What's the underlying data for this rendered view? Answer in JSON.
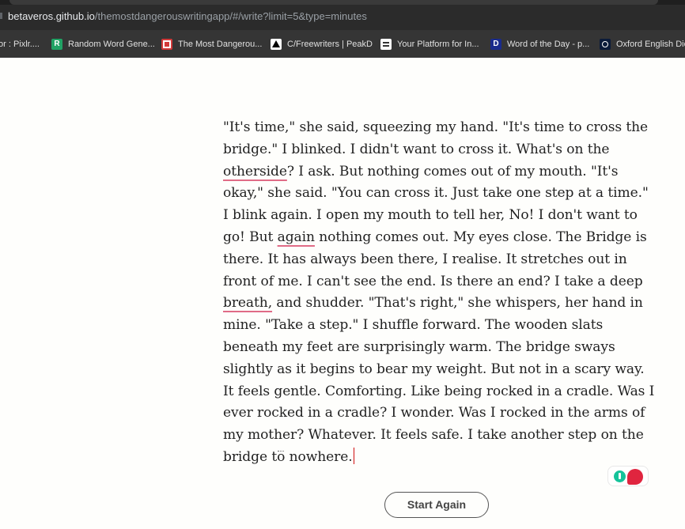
{
  "browser": {
    "url_host": "betaveros.github.io",
    "url_path": "/themostdangerouswritingapp/#/write?limit=5&type=minutes"
  },
  "bookmarks": [
    {
      "label": "or : Pixlr....",
      "icon": "none"
    },
    {
      "label": "Random Word Gene...",
      "icon": "random-word-icon"
    },
    {
      "label": "The Most Dangerou...",
      "icon": "most-dangerous-icon"
    },
    {
      "label": "C/Freewriters | PeakD",
      "icon": "peakd-icon"
    },
    {
      "label": "Your Platform for In...",
      "icon": "platform-icon"
    },
    {
      "label": "Word of the Day - p...",
      "icon": "word-of-day-icon"
    },
    {
      "label": "Oxford English Dic",
      "icon": "oxford-icon"
    }
  ],
  "editor": {
    "segments": [
      "\"It's time,\" she said, squeezing my hand. \"It's time to cross the bridge.\" I blinked. I didn't want to cross it. What's on the ",
      "otherside",
      "? I ask. But nothing comes out of my mouth. \"It's okay,\" she said. \"You can cross it. Just take one step at a time.\" I blink again. I open my mouth to tell her, No! I don't want to go! But ",
      "again",
      " nothing comes out. My eyes close. The Bridge is there. It has always been there, I realise. It stretches out in front of me. I can't see the end. Is there an end? I take a deep ",
      "breath,",
      " and shudder. \"That's right,\" she whispers, her hand in mine. \"Take a step.\" I shuffle forward. The wooden slats beneath my feet are surprisingly warm. The bridge sways slightly as it begins to bear my weight. But not in a scary way. It feels gentle. Comforting. Like being rocked in a cradle. Was I ever rocked in a cradle? I wonder. Was I rocked in the arms of my mother? Whatever. It feels safe. I take another step on the bridge to nowhere."
    ]
  },
  "actions": {
    "start_again": "Start Again"
  },
  "colors": {
    "background": "#fefefc",
    "spellcheck_underline": "#e06b86",
    "caret": "#d01010"
  }
}
